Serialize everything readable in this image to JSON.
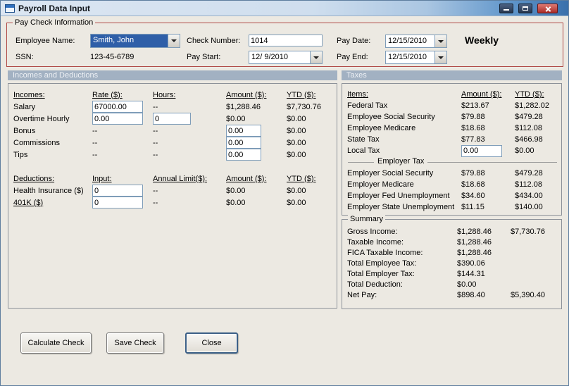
{
  "window": {
    "title": "Payroll Data Input"
  },
  "paycheck": {
    "group_label": "Pay Check Information",
    "employee_name": {
      "label": "Employee Name:",
      "value": "Smith, John"
    },
    "ssn": {
      "label": "SSN:",
      "value": "123-45-6789"
    },
    "check_number": {
      "label": "Check Number:",
      "value": "1014"
    },
    "pay_start": {
      "label": "Pay Start:",
      "value": "12/ 9/2010"
    },
    "pay_date": {
      "label": "Pay Date:",
      "value": "12/15/2010"
    },
    "pay_end": {
      "label": "Pay End:",
      "value": "12/15/2010"
    },
    "frequency": "Weekly"
  },
  "sections": {
    "left": "Incomes and Deductions",
    "right": "Taxes"
  },
  "incomes": {
    "headers": {
      "c0": "Incomes:",
      "c1": "Rate ($):",
      "c2": "Hours:",
      "c3": "Amount ($):",
      "c4": "YTD ($):"
    },
    "salary": {
      "label": "Salary",
      "rate": "67000.00",
      "hours": "--",
      "amount": "$1,288.46",
      "ytd": "$7,730.76"
    },
    "overtime": {
      "label": "Overtime Hourly",
      "rate": "0.00",
      "hours": "0",
      "amount": "$0.00",
      "ytd": "$0.00"
    },
    "bonus": {
      "label": "Bonus",
      "rate": "--",
      "hours": "--",
      "amount": "0.00",
      "ytd": "$0.00"
    },
    "commissions": {
      "label": "Commissions",
      "rate": "--",
      "hours": "--",
      "amount": "0.00",
      "ytd": "$0.00"
    },
    "tips": {
      "label": "Tips",
      "rate": "--",
      "hours": "--",
      "amount": "0.00",
      "ytd": "$0.00"
    }
  },
  "deductions": {
    "headers": {
      "c0": "Deductions:",
      "c1": "Input:",
      "c2": "Annual Limit($):",
      "c3": "Amount ($):",
      "c4": "YTD ($):"
    },
    "health": {
      "label": "Health Insurance  ($)",
      "input": "0",
      "limit": "--",
      "amount": "$0.00",
      "ytd": "$0.00"
    },
    "k401": {
      "label": "401K  ($)",
      "input": "0",
      "limit": "--",
      "amount": "$0.00",
      "ytd": "$0.00"
    }
  },
  "taxes": {
    "headers": {
      "c0": "Items:",
      "c1": "Amount ($):",
      "c2": "YTD ($):"
    },
    "federal": {
      "label": "Federal Tax",
      "amount": "$213.67",
      "ytd": "$1,282.02"
    },
    "emp_ss": {
      "label": "Employee Social Security",
      "amount": "$79.88",
      "ytd": "$479.28"
    },
    "emp_medicare": {
      "label": "Employee Medicare",
      "amount": "$18.68",
      "ytd": "$112.08"
    },
    "state": {
      "label": "State Tax",
      "amount": "$77.83",
      "ytd": "$466.98"
    },
    "local": {
      "label": "Local Tax",
      "amount": "0.00",
      "ytd": "$0.00"
    },
    "employer_header": "Employer Tax",
    "er_ss": {
      "label": "Employer Social Security",
      "amount": "$79.88",
      "ytd": "$479.28"
    },
    "er_medicare": {
      "label": "Employer Medicare",
      "amount": "$18.68",
      "ytd": "$112.08"
    },
    "er_fed_unemp": {
      "label": "Employer Fed Unemployment",
      "amount": "$34.60",
      "ytd": "$434.00"
    },
    "er_state_unemp": {
      "label": "Employer State Unemployment",
      "amount": "$11.15",
      "ytd": "$140.00"
    }
  },
  "summary": {
    "group_label": "Summary",
    "gross": {
      "label": "Gross Income:",
      "amount": "$1,288.46",
      "ytd": "$7,730.76"
    },
    "taxable": {
      "label": "Taxable Income:",
      "amount": "$1,288.46",
      "ytd": ""
    },
    "fica": {
      "label": "FICA Taxable Income:",
      "amount": "$1,288.46",
      "ytd": ""
    },
    "total_emp_tax": {
      "label": "Total Employee Tax:",
      "amount": "$390.06",
      "ytd": ""
    },
    "total_er_tax": {
      "label": "Total Employer Tax:",
      "amount": "$144.31",
      "ytd": ""
    },
    "total_deduction": {
      "label": "Total Deduction:",
      "amount": "$0.00",
      "ytd": ""
    },
    "net_pay": {
      "label": "Net Pay:",
      "amount": "$898.40",
      "ytd": "$5,390.40"
    }
  },
  "buttons": {
    "calculate": "Calculate Check",
    "save": "Save Check",
    "close": "Close"
  }
}
